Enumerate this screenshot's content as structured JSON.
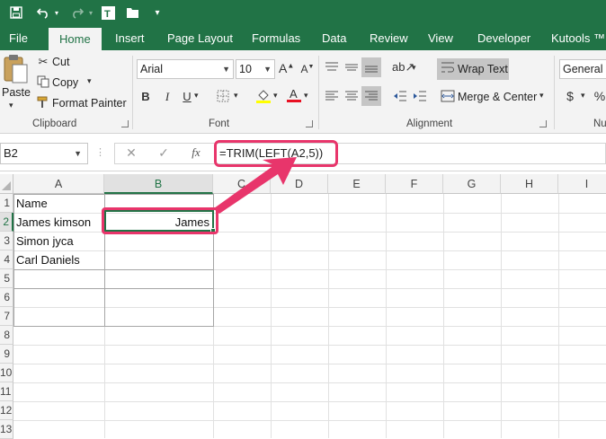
{
  "qat": {
    "save_icon": "save-icon",
    "undo_icon": "undo-icon",
    "redo_icon": "redo-icon",
    "text_icon": "text-toolbox-icon",
    "folder_icon": "open-folder-icon",
    "customize_icon": "customize-qat-icon"
  },
  "tabs": [
    "File",
    "Home",
    "Insert",
    "Page Layout",
    "Formulas",
    "Data",
    "Review",
    "View",
    "Developer",
    "Kutools ™"
  ],
  "ribbon": {
    "clipboard": {
      "paste": "Paste",
      "cut": "Cut",
      "copy": "Copy",
      "format_painter": "Format Painter",
      "label": "Clipboard"
    },
    "font": {
      "name": "Arial",
      "size": "10",
      "label": "Font",
      "bold": "B",
      "italic": "I",
      "underline": "U"
    },
    "alignment": {
      "wrap_text": "Wrap Text",
      "merge_center": "Merge & Center",
      "label": "Alignment"
    },
    "number": {
      "format": "General",
      "label": "Nu",
      "currency": "$",
      "percent": "%"
    }
  },
  "formula_bar": {
    "name_box": "B2",
    "cancel": "✕",
    "enter": "✓",
    "fx": "fx",
    "formula": "=TRIM(LEFT(A2,5))"
  },
  "sheet": {
    "columns": [
      "A",
      "B",
      "C",
      "D",
      "E",
      "F",
      "G",
      "H",
      "I"
    ],
    "rows": [
      "1",
      "2",
      "3",
      "4",
      "5",
      "6",
      "7",
      "8",
      "9",
      "10",
      "11",
      "12",
      "13"
    ],
    "cells": {
      "A1": "Name",
      "A2": "James kimson",
      "A3": "Simon jyca",
      "A4": "Carl Daniels",
      "B2": "James"
    },
    "selected_cell": "B2"
  },
  "annotation_color": "#e8356b",
  "accent_color": "#217346"
}
